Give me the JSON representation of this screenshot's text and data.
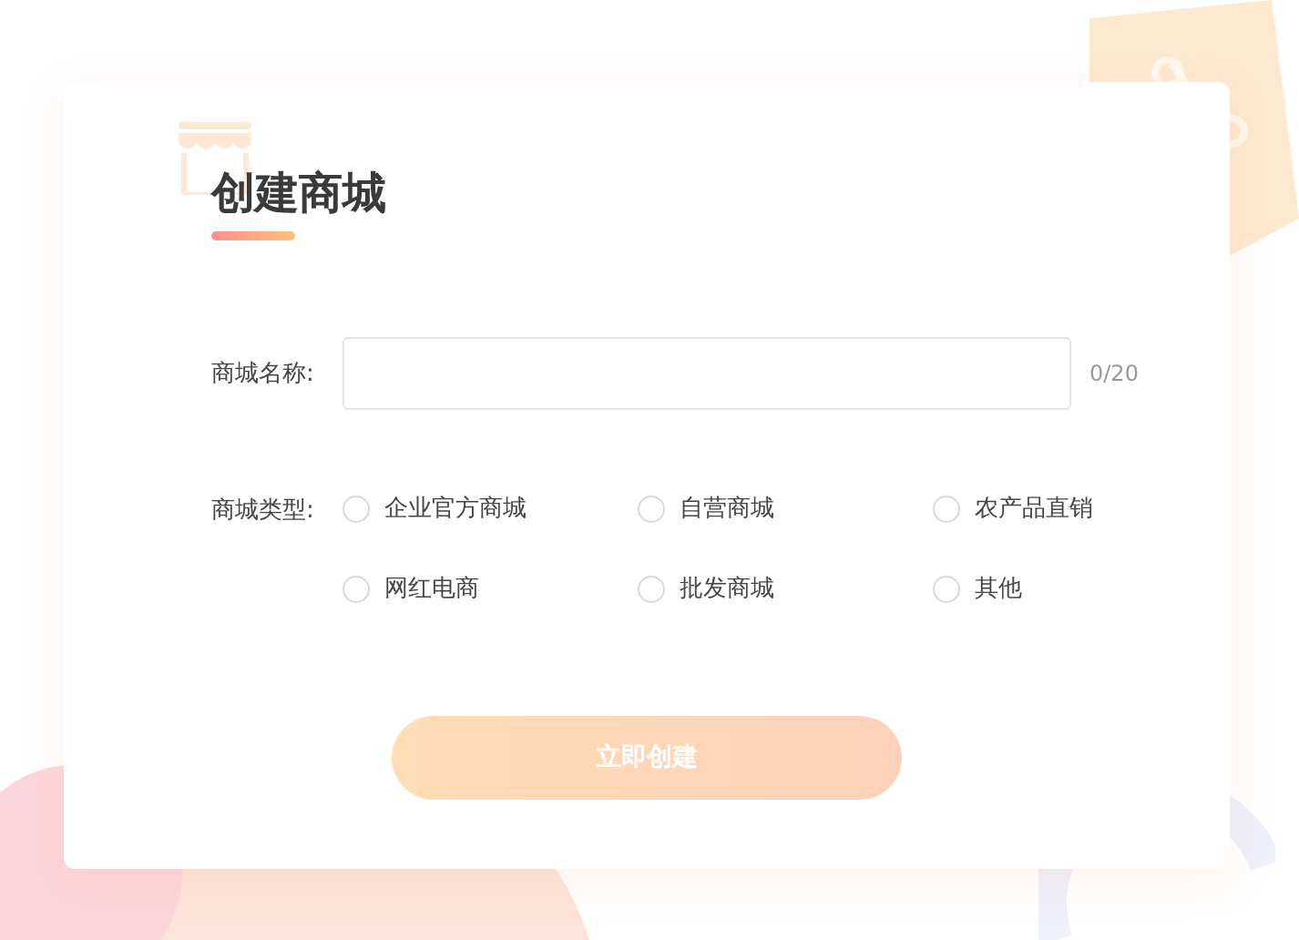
{
  "title": "创建商城",
  "name_field": {
    "label": "商城名称:",
    "counter": "0/20"
  },
  "type_field": {
    "label": "商城类型:",
    "options": [
      {
        "label": "企业官方商城",
        "selected": false
      },
      {
        "label": "自营商城",
        "selected": false
      },
      {
        "label": "农产品直销",
        "selected": false
      },
      {
        "label": "网红电商",
        "selected": false
      },
      {
        "label": "批发商城",
        "selected": false
      },
      {
        "label": "其他",
        "selected": false
      }
    ]
  },
  "submit": {
    "label": "立即创建",
    "disabled": true
  }
}
